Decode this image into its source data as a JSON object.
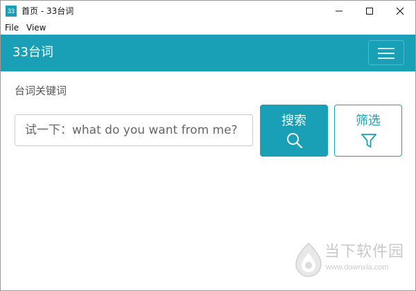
{
  "window": {
    "icon_text": "33",
    "title": "首页 - 33台词"
  },
  "menu": {
    "items": [
      {
        "label": "File"
      },
      {
        "label": "View"
      }
    ]
  },
  "header": {
    "brand": "33台词"
  },
  "search": {
    "label": "台词关键词",
    "placeholder": "试一下：what do you want from me?",
    "value": "",
    "search_button_label": "搜索",
    "filter_button_label": "筛选"
  },
  "colors": {
    "accent": "#1aa0b6",
    "background": "#ffffff"
  },
  "icons": {
    "app": "app-icon",
    "minimize": "minimize-icon",
    "maximize": "maximize-icon",
    "close": "close-icon",
    "menu": "hamburger-icon",
    "search": "search-icon",
    "filter": "filter-icon"
  },
  "watermark": {
    "name": "当下软件园",
    "url": "www.downxia.com"
  }
}
